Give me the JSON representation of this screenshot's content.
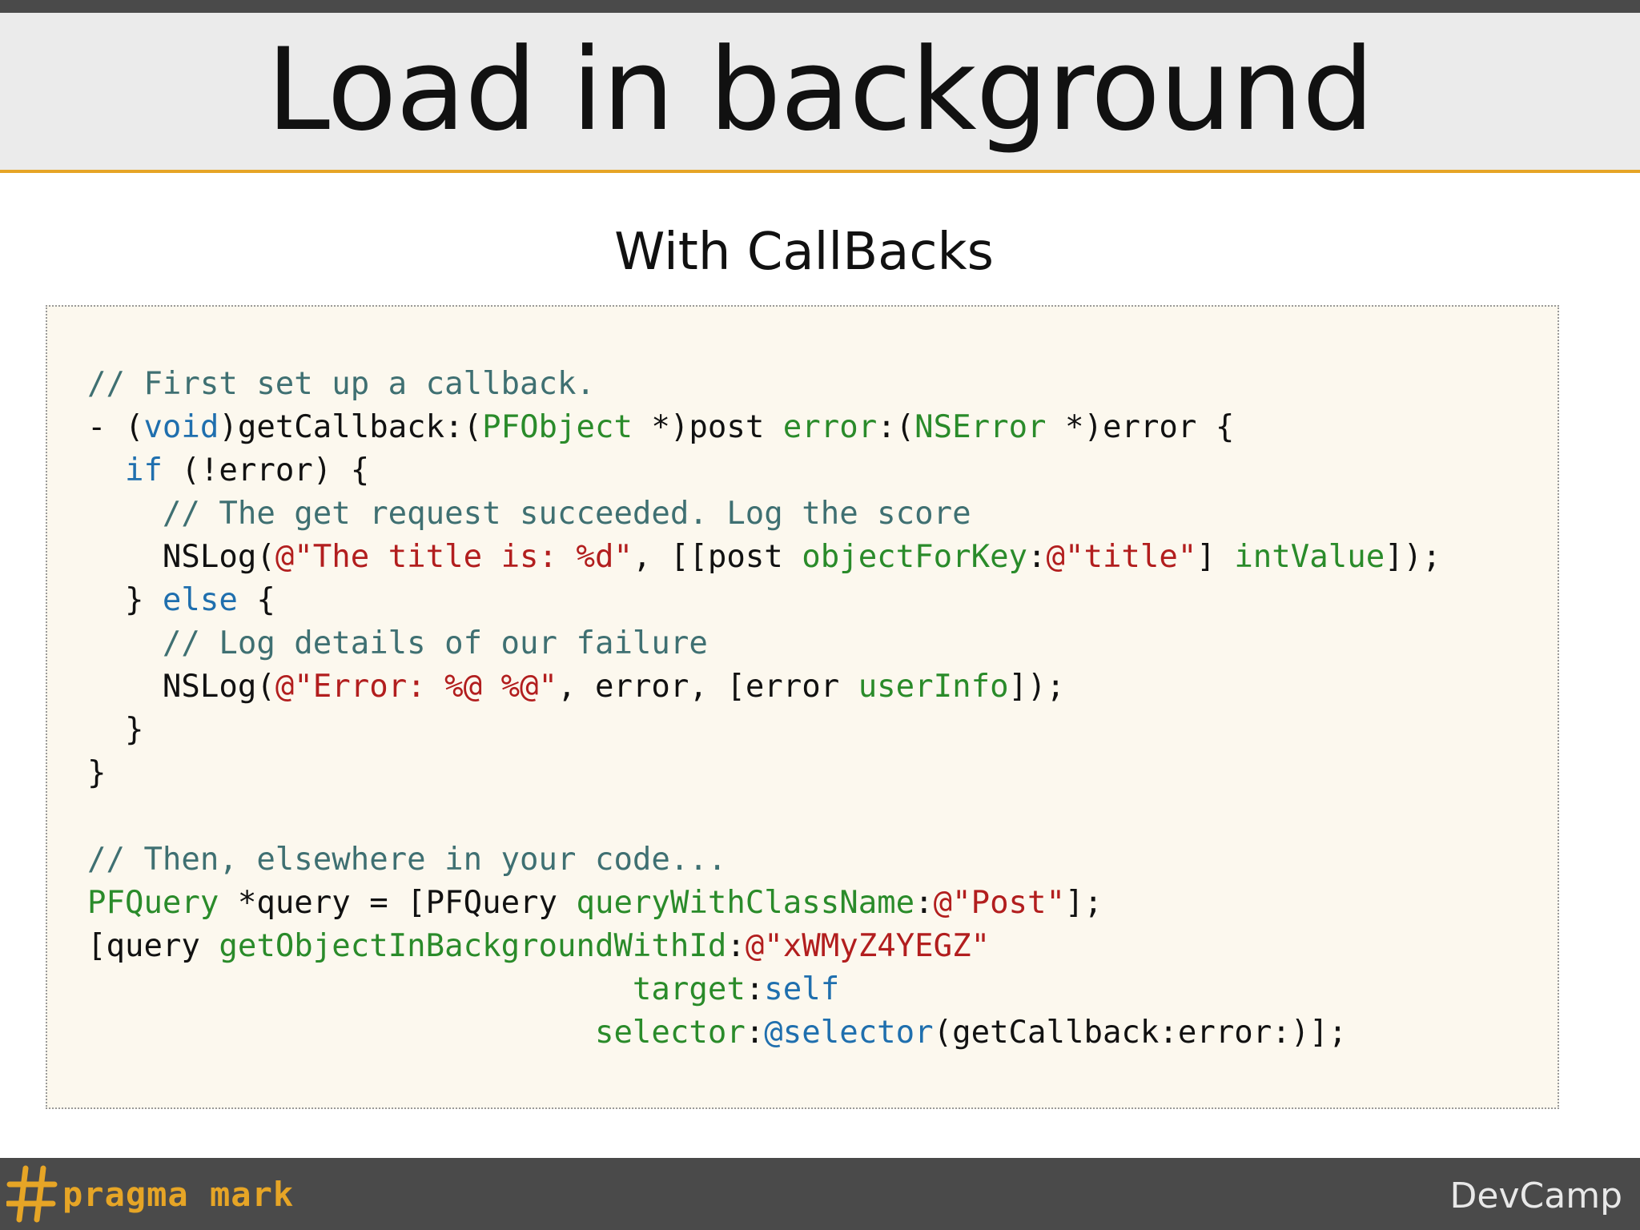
{
  "slide": {
    "title": "Load in background",
    "subtitle": "With CallBacks"
  },
  "code_lines": [
    [
      {
        "t": "// First set up a callback.",
        "c": "c"
      }
    ],
    [
      {
        "t": "- (",
        "c": ""
      },
      {
        "t": "void",
        "c": "k"
      },
      {
        "t": ")getCallback:(",
        "c": ""
      },
      {
        "t": "PFObject",
        "c": "t"
      },
      {
        "t": " *)post ",
        "c": ""
      },
      {
        "t": "error",
        "c": "t"
      },
      {
        "t": ":(",
        "c": ""
      },
      {
        "t": "NSError",
        "c": "t"
      },
      {
        "t": " *)error {",
        "c": ""
      }
    ],
    [
      {
        "t": "  ",
        "c": ""
      },
      {
        "t": "if",
        "c": "k"
      },
      {
        "t": " (!error) {",
        "c": ""
      }
    ],
    [
      {
        "t": "    ",
        "c": ""
      },
      {
        "t": "// The get request succeeded. Log the score",
        "c": "c"
      }
    ],
    [
      {
        "t": "    NSLog(",
        "c": ""
      },
      {
        "t": "@\"The title is: %d\"",
        "c": "s"
      },
      {
        "t": ", [[post ",
        "c": ""
      },
      {
        "t": "objectForKey",
        "c": "t"
      },
      {
        "t": ":",
        "c": ""
      },
      {
        "t": "@\"title\"",
        "c": "s"
      },
      {
        "t": "] ",
        "c": ""
      },
      {
        "t": "intValue",
        "c": "t"
      },
      {
        "t": "]);",
        "c": ""
      }
    ],
    [
      {
        "t": "  } ",
        "c": ""
      },
      {
        "t": "else",
        "c": "k"
      },
      {
        "t": " {",
        "c": ""
      }
    ],
    [
      {
        "t": "    ",
        "c": ""
      },
      {
        "t": "// Log details of our failure",
        "c": "c"
      }
    ],
    [
      {
        "t": "    NSLog(",
        "c": ""
      },
      {
        "t": "@\"Error: %@ %@\"",
        "c": "s"
      },
      {
        "t": ", error, [error ",
        "c": ""
      },
      {
        "t": "userInfo",
        "c": "t"
      },
      {
        "t": "]);",
        "c": ""
      }
    ],
    [
      {
        "t": "  }",
        "c": ""
      }
    ],
    [
      {
        "t": "}",
        "c": ""
      }
    ],
    [],
    [
      {
        "t": "// Then, elsewhere in your code...",
        "c": "c"
      }
    ],
    [
      {
        "t": "PFQuery",
        "c": "t"
      },
      {
        "t": " *query = [PFQuery ",
        "c": ""
      },
      {
        "t": "queryWithClassName",
        "c": "t"
      },
      {
        "t": ":",
        "c": ""
      },
      {
        "t": "@\"Post\"",
        "c": "s"
      },
      {
        "t": "];",
        "c": ""
      }
    ],
    [
      {
        "t": "[query ",
        "c": ""
      },
      {
        "t": "getObjectInBackgroundWithId",
        "c": "t"
      },
      {
        "t": ":",
        "c": ""
      },
      {
        "t": "@\"xWMyZ4YEGZ\"",
        "c": "s"
      }
    ],
    [
      {
        "t": "                             ",
        "c": ""
      },
      {
        "t": "target",
        "c": "t"
      },
      {
        "t": ":",
        "c": ""
      },
      {
        "t": "self",
        "c": "k"
      }
    ],
    [
      {
        "t": "                           ",
        "c": ""
      },
      {
        "t": "selector",
        "c": "t"
      },
      {
        "t": ":",
        "c": ""
      },
      {
        "t": "@selector",
        "c": "k"
      },
      {
        "t": "(getCallback:error:)];",
        "c": ""
      }
    ]
  ],
  "footer": {
    "logo_text": "pragma mark",
    "brand": "DevCamp"
  },
  "icons": {
    "logo": "hash-icon"
  },
  "colors": {
    "accent": "#e6a526",
    "comment": "#3f7072",
    "keyword": "#1f6fae",
    "type_or_method": "#2a8b2a",
    "string": "#b21e1e",
    "code_background": "#fcf8ee",
    "bar": "#4a4a4a"
  }
}
